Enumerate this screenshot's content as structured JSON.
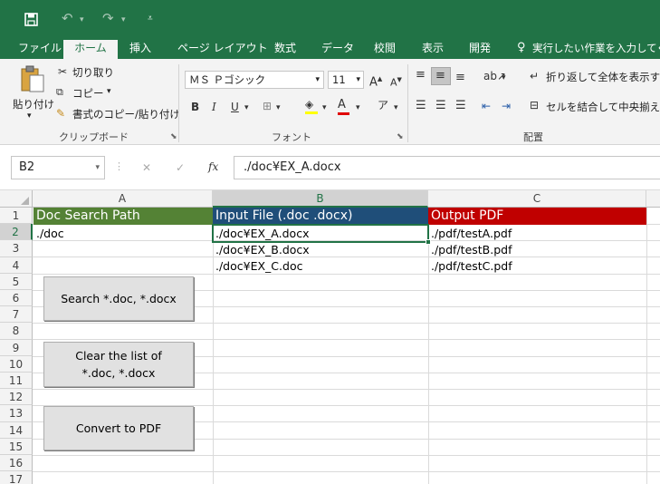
{
  "titlebar": {
    "save_icon": "save-icon",
    "undo_icon": "undo-icon",
    "redo_icon": "redo-icon",
    "customize_icon": "customize-qat-icon"
  },
  "tabs": [
    "ファイル",
    "ホーム",
    "挿入",
    "ページ レイアウト",
    "数式",
    "データ",
    "校閲",
    "表示",
    "開発"
  ],
  "tellme": "実行したい作業を入力してくだ",
  "ribbon": {
    "paste": "貼り付け",
    "cut": "切り取り",
    "copy": "コピー",
    "format_painter": "書式のコピー/貼り付け",
    "clipboard_label": "クリップボード",
    "font_name": "ＭＳ Ｐゴシック",
    "font_size": "11",
    "bold": "B",
    "italic": "I",
    "underline": "U",
    "font_label": "フォント",
    "wrap_text": "折り返して全体を表示する",
    "merge_center": "セルを結合して中央揃え",
    "alignment_label": "配置"
  },
  "formula_bar": {
    "name_box": "B2",
    "cancel": "✕",
    "enter": "✓",
    "fx": "fx",
    "formula": "./doc¥EX_A.docx"
  },
  "columns": [
    "A",
    "B",
    "C"
  ],
  "rows": [
    "1",
    "2",
    "3",
    "4",
    "5",
    "6",
    "7",
    "8",
    "9",
    "10",
    "11",
    "12",
    "13",
    "14",
    "15",
    "16",
    "17"
  ],
  "headers": {
    "a1": "Doc Search Path",
    "b1": "Input File (.doc .docx)",
    "c1": "Output PDF"
  },
  "cells": {
    "a2": "./doc",
    "b2": "./doc¥EX_A.docx",
    "b3": "./doc¥EX_B.docx",
    "b4": "./doc¥EX_C.doc",
    "c2": "./pdf/testA.pdf",
    "c3": "./pdf/testB.pdf",
    "c4": "./pdf/testC.pdf"
  },
  "buttons": {
    "search": "Search *.doc, *.docx",
    "clear_line1": "Clear the list of",
    "clear_line2": "*.doc, *.docx",
    "convert": "Convert to PDF"
  },
  "colors": {
    "excel_green": "#217346",
    "header_a": "#548235",
    "header_b": "#1f4e79",
    "header_c": "#c00000"
  }
}
